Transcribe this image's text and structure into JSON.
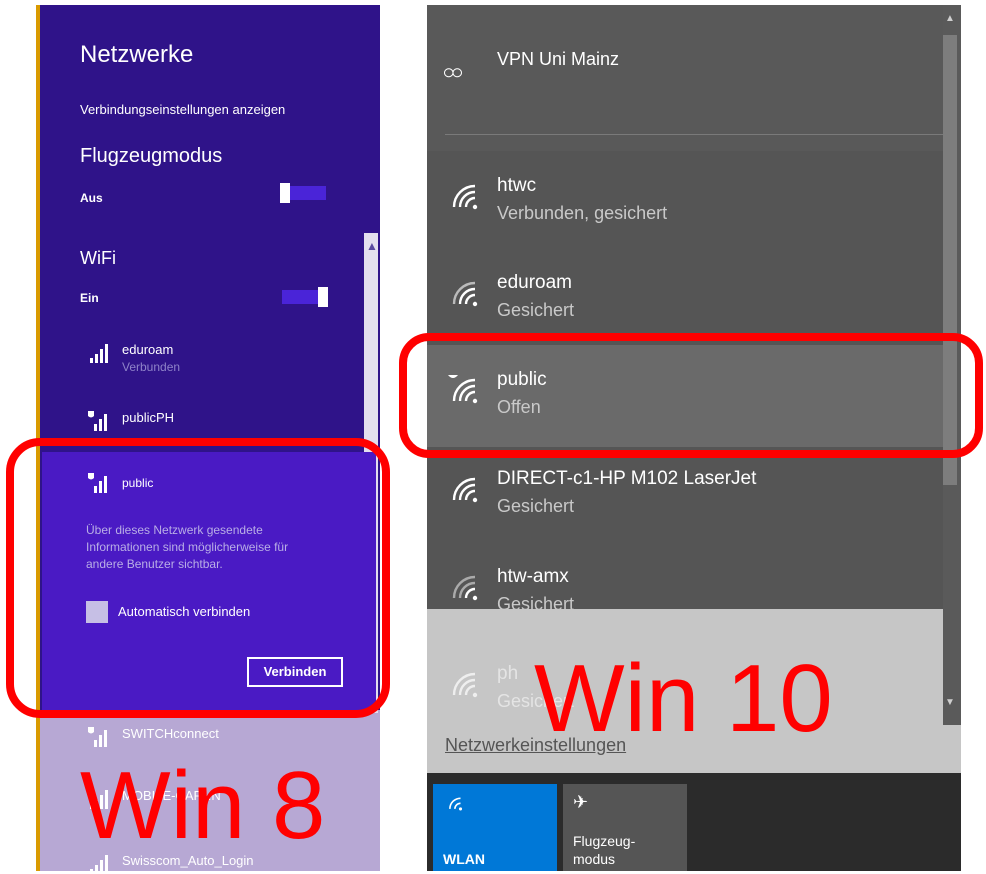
{
  "win8": {
    "title": "Netzwerke",
    "settings_link": "Verbindungseinstellungen anzeigen",
    "airplane_heading": "Flugzeugmodus",
    "airplane_state": "Aus",
    "wifi_heading": "WiFi",
    "wifi_state": "Ein",
    "networks": [
      {
        "name": "eduroam",
        "status": "Verbunden"
      },
      {
        "name": "publicPH",
        "status": ""
      },
      {
        "name": "public",
        "status": ""
      },
      {
        "name": "SWITCHconnect",
        "status": ""
      },
      {
        "name": "MOBILE-CAP...N",
        "status": ""
      },
      {
        "name": "Swisscom_Auto_Login",
        "status": ""
      }
    ],
    "warning": "Über dieses Netzwerk gesendete Informationen sind möglicherweise für andere Benutzer sichtbar.",
    "auto_connect_label": "Automatisch verbinden",
    "connect_button": "Verbinden"
  },
  "win10": {
    "vpn_label": "VPN Uni Mainz",
    "networks": [
      {
        "name": "htwc",
        "status": "Verbunden, gesichert"
      },
      {
        "name": "eduroam",
        "status": "Gesichert"
      },
      {
        "name": "public",
        "status": "Offen"
      },
      {
        "name": "DIRECT-c1-HP M102 LaserJet",
        "status": "Gesichert"
      },
      {
        "name": "htw-amx",
        "status": "Gesichert"
      },
      {
        "name": "ph",
        "status": "Gesichert"
      }
    ],
    "settings_link": "Netzwerkeinstellungen",
    "tiles": [
      {
        "label": "WLAN",
        "icon": "wifi-icon"
      },
      {
        "label": "Flugzeug-\nmodus",
        "icon": "airplane-icon"
      }
    ]
  },
  "labels": {
    "win8": "Win 8",
    "win10": "Win 10"
  },
  "colors": {
    "win8_bg": "#2f1389",
    "win8_selected": "#4a1ac4",
    "win10_bg": "#555555",
    "accent_red": "#ff0000",
    "win10_tile_active": "#0078d7"
  }
}
